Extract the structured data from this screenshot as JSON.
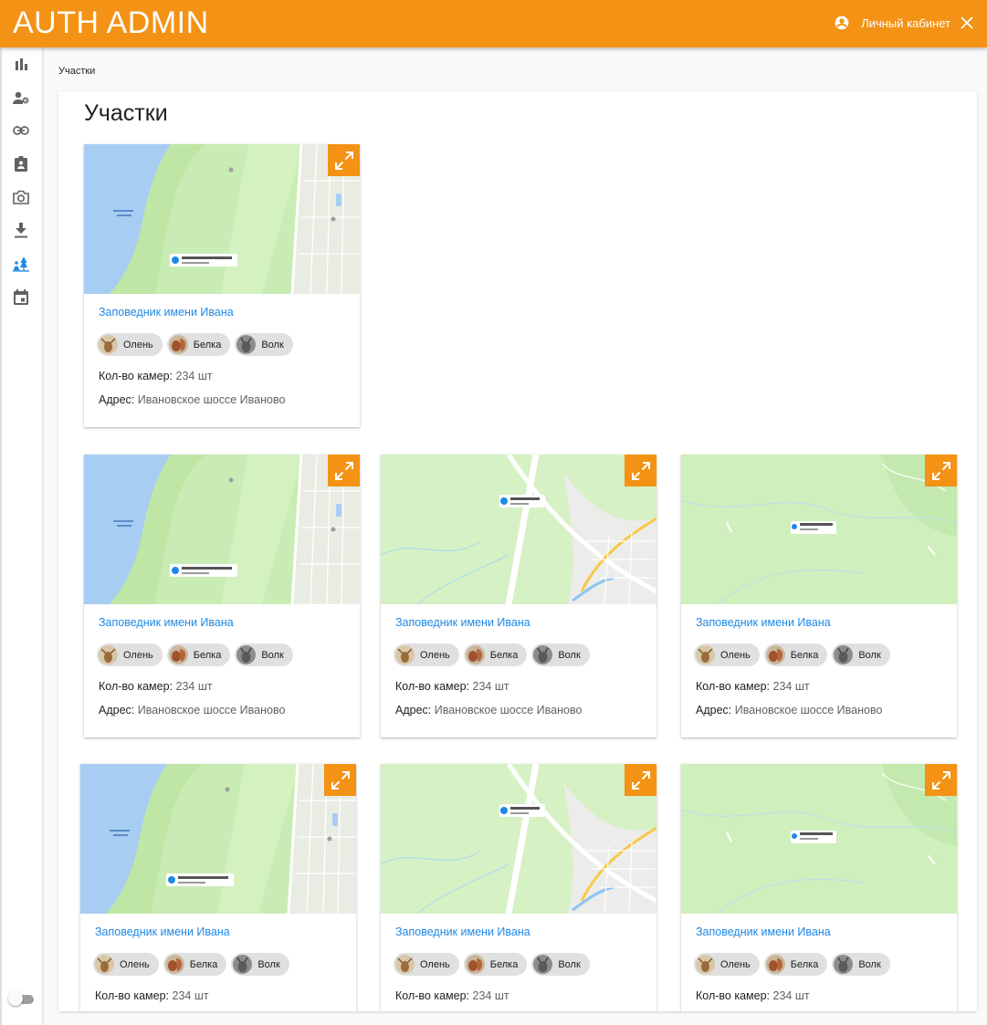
{
  "app": {
    "title": "AUTH ADMIN",
    "account_label": "Личный кабинет"
  },
  "sidebar": {
    "items": [
      {
        "name": "charts",
        "icon": "bar-chart-icon"
      },
      {
        "name": "users",
        "icon": "user-settings-icon"
      },
      {
        "name": "links",
        "icon": "link-icon"
      },
      {
        "name": "assignments",
        "icon": "assignment-icon"
      },
      {
        "name": "cameras",
        "icon": "camera-icon"
      },
      {
        "name": "downloads",
        "icon": "download-icon"
      },
      {
        "name": "sites",
        "icon": "nature-icon",
        "active": true
      },
      {
        "name": "events",
        "icon": "calendar-icon"
      }
    ],
    "active_color": "#1e88e5"
  },
  "breadcrumb": "Участки",
  "page_title": "Участки",
  "accent_color": "#f39214",
  "cards": [
    {
      "title": "Заповедник имени Ивана",
      "map": "river",
      "chips": [
        "Олень",
        "Белка",
        "Волк"
      ],
      "cameras_label": "Кол-во камер:",
      "cameras_value": "234 шт",
      "address_label": "Адрес:",
      "address_value": "Ивановское шоссе Иваново"
    },
    {
      "title": "Заповедник имени Ивана",
      "map": "river",
      "chips": [
        "Олень",
        "Белка",
        "Волк"
      ],
      "cameras_label": "Кол-во камер:",
      "cameras_value": "234 шт",
      "address_label": "Адрес:",
      "address_value": "Ивановское шоссе Иваново"
    },
    {
      "title": "Заповедник имени Ивана",
      "map": "city",
      "chips": [
        "Олень",
        "Белка",
        "Волк"
      ],
      "cameras_label": "Кол-во камер:",
      "cameras_value": "234 шт",
      "address_label": "Адрес:",
      "address_value": "Ивановское шоссе Иваново"
    },
    {
      "title": "Заповедник имени Ивана",
      "map": "forest",
      "chips": [
        "Олень",
        "Белка",
        "Волк"
      ],
      "cameras_label": "Кол-во камер:",
      "cameras_value": "234 шт",
      "address_label": "Адрес:",
      "address_value": "Ивановское шоссе Иваново"
    },
    {
      "title": "Заповедник имени Ивана",
      "map": "river",
      "chips": [
        "Олень",
        "Белка",
        "Волк"
      ],
      "cameras_label": "Кол-во камер:",
      "cameras_value": "234 шт"
    },
    {
      "title": "Заповедник имени Ивана",
      "map": "city",
      "chips": [
        "Олень",
        "Белка",
        "Волк"
      ],
      "cameras_label": "Кол-во камер:",
      "cameras_value": "234 шт"
    },
    {
      "title": "Заповедник имени Ивана",
      "map": "forest",
      "chips": [
        "Олень",
        "Белка",
        "Волк"
      ],
      "cameras_label": "Кол-во камер:",
      "cameras_value": "234 шт"
    }
  ]
}
